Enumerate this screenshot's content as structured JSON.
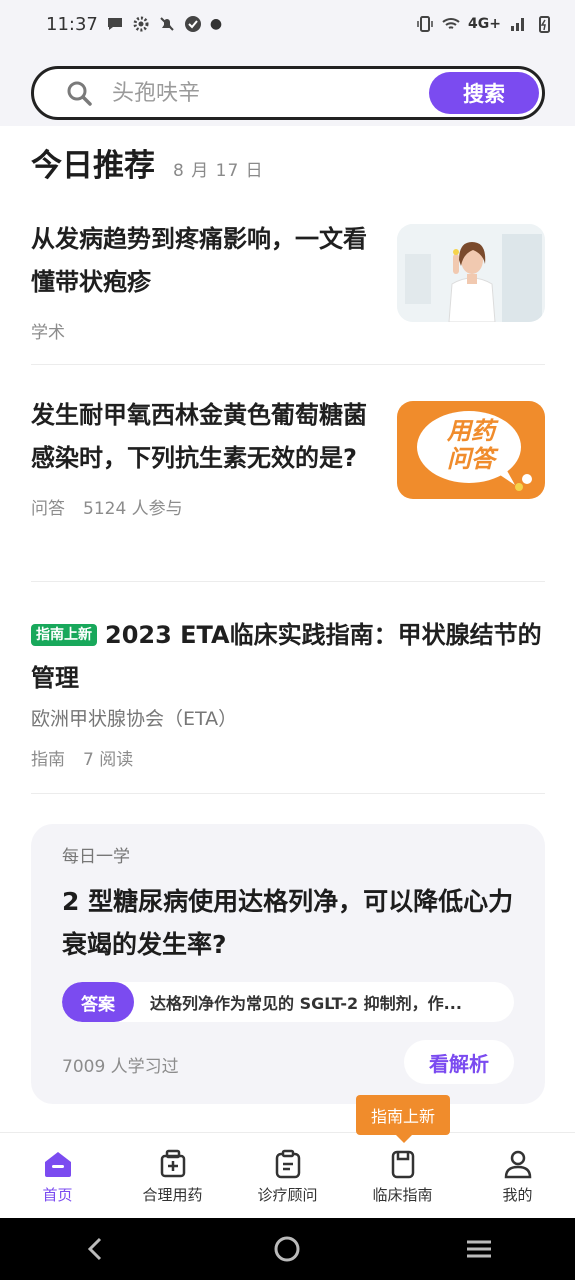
{
  "status_bar": {
    "time": "11:37",
    "network": "4G+"
  },
  "search": {
    "placeholder": "头孢呋辛",
    "button": "搜索"
  },
  "recommend": {
    "title": "今日推荐",
    "date": "8 月 17 日"
  },
  "articles": [
    {
      "title": "从发病趋势到疼痛影响，一文看懂带状疱疹",
      "tag": "学术"
    },
    {
      "title": "发生耐甲氧西林金黄色葡萄糖菌感染时，下列抗生素无效的是?",
      "tag": "问答",
      "participants": "5124 人参与",
      "thumb_text_1": "用药",
      "thumb_text_2": "问答"
    },
    {
      "badge": "指南上新",
      "title": "2023 ETA临床实践指南：甲状腺结节的管理",
      "source": "欧洲甲状腺协会（ETA）",
      "tag": "指南",
      "reads": "7 阅读"
    }
  ],
  "daily": {
    "label": "每日一学",
    "question": "2 型糖尿病使用达格列净，可以降低心力衰竭的发生率?",
    "answer_tag": "答案",
    "answer_text": "达格列净作为常见的 SGLT-2 抑制剂，作...",
    "count": "7009  人学习过",
    "view_button": "看解析"
  },
  "tooltip": "指南上新",
  "tabs": [
    {
      "label": "首页",
      "icon": "home-icon",
      "active": true
    },
    {
      "label": "合理用药",
      "icon": "medicine-box-icon"
    },
    {
      "label": "诊疗顾问",
      "icon": "clipboard-icon"
    },
    {
      "label": "临床指南",
      "icon": "book-icon"
    },
    {
      "label": "我的",
      "icon": "user-icon"
    }
  ],
  "colors": {
    "accent": "#7b4bf0",
    "guide_green": "#18a85b",
    "tip_orange": "#f08c2c"
  }
}
